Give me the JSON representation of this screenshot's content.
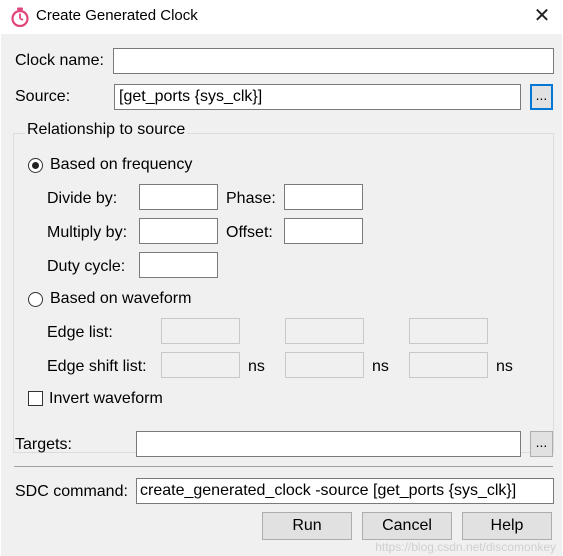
{
  "window": {
    "title": "Create Generated Clock",
    "close_glyph": "✕"
  },
  "clock_name": {
    "label": "Clock name:",
    "value": ""
  },
  "source": {
    "label": "Source:",
    "value": "[get_ports {sys_clk}]",
    "browse_label": "..."
  },
  "relationship": {
    "group_title": "Relationship to source",
    "frequency": {
      "label": "Based on frequency",
      "selected": true,
      "divide_by": {
        "label": "Divide by:",
        "value": ""
      },
      "phase": {
        "label": "Phase:",
        "value": ""
      },
      "multiply_by": {
        "label": "Multiply by:",
        "value": ""
      },
      "offset": {
        "label": "Offset:",
        "value": ""
      },
      "duty_cycle": {
        "label": "Duty cycle:",
        "value": ""
      }
    },
    "waveform": {
      "label": "Based on waveform",
      "selected": false,
      "edge_list_label": "Edge list:",
      "edge_shift_label": "Edge shift list:",
      "unit": "ns"
    },
    "invert": {
      "label": "Invert waveform",
      "checked": false
    }
  },
  "targets": {
    "label": "Targets:",
    "value": "",
    "browse_label": "..."
  },
  "sdc": {
    "label": "SDC command:",
    "value": "create_generated_clock -source [get_ports {sys_clk}]"
  },
  "buttons": {
    "run": "Run",
    "cancel": "Cancel",
    "help": "Help"
  },
  "watermark": "https://blog.csdn.net/discomonkey"
}
